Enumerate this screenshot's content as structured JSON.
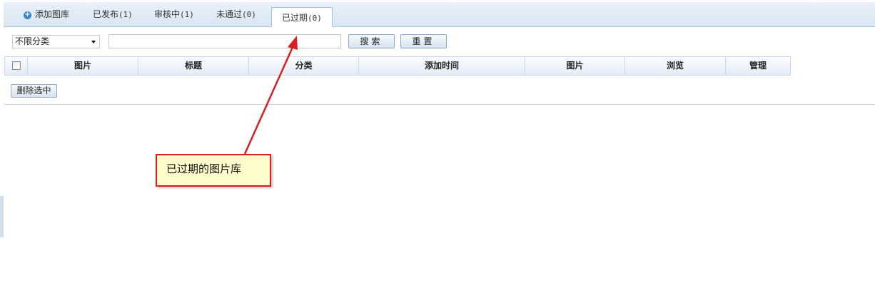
{
  "tabs": [
    {
      "label": "添加图库",
      "icon": "plus-circle-icon"
    },
    {
      "label": "已发布",
      "count": "(1)"
    },
    {
      "label": "审核中",
      "count": "(1)"
    },
    {
      "label": "未通过",
      "count": "(0)"
    },
    {
      "label": "已过期",
      "count": "(0)",
      "active": true
    }
  ],
  "filter": {
    "category_select": "不限分类",
    "search_value": "",
    "search_button": "搜索",
    "reset_button": "重置"
  },
  "table": {
    "headers": [
      "图片",
      "标题",
      "分类",
      "添加时间",
      "图片",
      "浏览",
      "管理"
    ]
  },
  "delete_selected": "删除选中",
  "annotation": {
    "text": "已过期的图片库",
    "color": "#d62020"
  }
}
